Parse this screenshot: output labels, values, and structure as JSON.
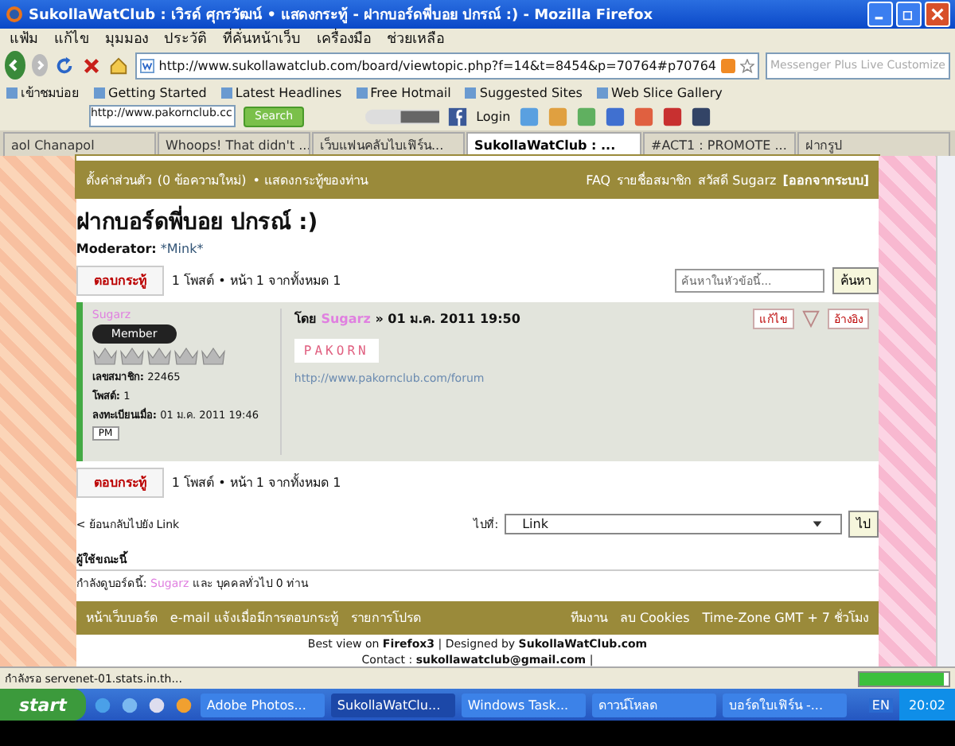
{
  "window": {
    "title": "SukollaWatClub : เวิรด์ ศุกรวัฒน์ • แสดงกระทู้ - ฝากบอร์ดพี่บอย ปกรณ์ :) - Mozilla Firefox"
  },
  "menu": [
    "แฟ้ม",
    "แก้ไข",
    "มุมมอง",
    "ประวัติ",
    "ที่คั่นหน้าเว็บ",
    "เครื่องมือ",
    "ช่วยเหลือ"
  ],
  "address": {
    "value": "http://www.sukollawatclub.com/board/viewtopic.php?f=14&t=8454&p=70764#p70764"
  },
  "web_search": {
    "placeholder": "Messenger Plus Live Customize"
  },
  "bookmarks": [
    "เข้าชมบ่อย",
    "Getting Started",
    "Latest Headlines",
    "Free Hotmail",
    "Suggested Sites",
    "Web Slice Gallery"
  ],
  "toolbar": {
    "url": "http://www.pakornclub.cc",
    "search_button": "Search",
    "login": "Login"
  },
  "tabs": [
    {
      "label": "aol Chanapol",
      "selected": false
    },
    {
      "label": "Whoops! That didn't ...",
      "selected": false
    },
    {
      "label": "เว็บแฟนคลับไบเฟิร์น...",
      "selected": false
    },
    {
      "label": "SukollaWatClub : ...",
      "selected": true
    },
    {
      "label": "#ACT1 : PROMOTE ...",
      "selected": false
    },
    {
      "label": "ฝากรูป",
      "selected": false
    }
  ],
  "forum_nav": {
    "settings": "ตั้งค่าส่วนตัว",
    "new_messages": "(0 ข้อความใหม่)",
    "own_posts": "• แสดงกระทู้ของท่าน",
    "faq": "FAQ",
    "members": "รายชื่อสมาชิก",
    "greeting": "สวัสดี Sugarz",
    "logout": "[ออกจากระบบ]"
  },
  "topic": {
    "title": "ฝากบอร์ดพี่บอย ปกรณ์ :)",
    "moderator_label": "Moderator:",
    "moderator": "*Mink*"
  },
  "pagination": [
    {
      "reply": "ตอบกระทู้",
      "info": "1 โพสต์ • หน้า 1 จากทั้งหมด 1"
    },
    {
      "reply": "ตอบกระทู้",
      "info": "1 โพสต์ • หน้า 1 จากทั้งหมด 1"
    }
  ],
  "topic_search": {
    "placeholder": "ค้นหาในหัวข้อนี้...",
    "button": "ค้นหา"
  },
  "post": {
    "author": "Sugarz",
    "rank": "Member",
    "stars": 0,
    "profile": [
      {
        "label": "เลขสมาชิก:",
        "value": "22465"
      },
      {
        "label": "โพสต์:",
        "value": "1"
      },
      {
        "label": "ลงทะเบียนเมื่อ:",
        "value": "01 ม.ค. 2011 19:46"
      }
    ],
    "pm": "PM",
    "by": "โดย",
    "by_user": "Sugarz",
    "date": "» 01 ม.ค. 2011 19:50",
    "edit": "แก้ไข",
    "quote": "อ้างอิง",
    "signature_banner": "PAKORN",
    "link": "http://www.pakornclub.com/forum"
  },
  "back_link": "< ย้อนกลับไปยัง Link",
  "jump": {
    "label": "ไปที่:",
    "value": "Link",
    "button": "ไป"
  },
  "online": {
    "heading": "ผู้ใช้ขณะนี้",
    "prefix": "กำลังดูบอร์ดนี้:",
    "user": "Sugarz",
    "suffix": "และ บุคคลทั่วไป 0 ท่าน"
  },
  "footer": {
    "left": [
      "หน้าเว็บบอร์ด",
      "e-mail แจ้งเมื่อมีการตอบกระทู้",
      "รายการโปรด"
    ],
    "right": [
      "ทีมงาน",
      "ลบ Cookies",
      "Time-Zone GMT + 7 ชั่วโมง"
    ]
  },
  "credits": {
    "best_view": "Best view on",
    "browser": "Firefox3",
    "designed": "| Designed by",
    "site": "SukollaWatClub.com",
    "contact": "Contact :",
    "email": "sukollawatclub@gmail.com",
    "sep": "|"
  },
  "status_bar": {
    "text": "กำลังรอ servenet-01.stats.in.th...",
    "level": 0.95
  },
  "taskbar": {
    "start": "start",
    "items": [
      {
        "label": "Adobe Photos...",
        "selected": false
      },
      {
        "label": "SukollaWatClu...",
        "selected": true
      },
      {
        "label": "Windows Task...",
        "selected": false
      },
      {
        "label": "ดาวน์โหลด",
        "selected": false
      },
      {
        "label": "บอร์ดใบเฟิร์น -...",
        "selected": false
      }
    ],
    "language": "EN",
    "clock": "20:02"
  }
}
